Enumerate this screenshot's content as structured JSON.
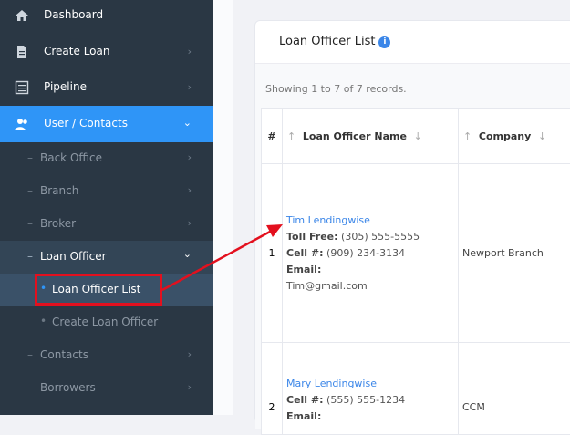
{
  "sidebar": {
    "items": [
      {
        "label": "Dashboard"
      },
      {
        "label": "Create Loan"
      },
      {
        "label": "Pipeline"
      },
      {
        "label": "User / Contacts"
      }
    ],
    "sub_items": [
      {
        "label": "Back Office"
      },
      {
        "label": "Branch"
      },
      {
        "label": "Broker"
      },
      {
        "label": "Loan Officer"
      }
    ],
    "loan_officer_children": [
      {
        "label": "Loan Officer List"
      },
      {
        "label": "Create Loan Officer"
      }
    ],
    "after_items": [
      {
        "label": "Contacts"
      },
      {
        "label": "Borrowers"
      }
    ],
    "active_color": "#2f95f7",
    "highlight_color": "#e3101e"
  },
  "card": {
    "title": "Loan Officer List",
    "showing": "Showing 1 to 7 of 7 records.",
    "columns": [
      "#",
      "Loan Officer Name",
      "Company"
    ],
    "rows": [
      {
        "num": "1",
        "name": "Tim Lendingwise",
        "toll_label": "Toll Free:",
        "toll": "(305) 555-5555",
        "cell_label": "Cell #:",
        "cell": "(909) 234-3134",
        "email_label": "Email:",
        "email": "Tim@gmail.com",
        "company": "Newport Branch"
      },
      {
        "num": "2",
        "name": "Mary Lendingwise",
        "cell_label": "Cell #:",
        "cell": "(555) 555-1234",
        "email_label": "Email:",
        "company": "CCM"
      }
    ]
  }
}
